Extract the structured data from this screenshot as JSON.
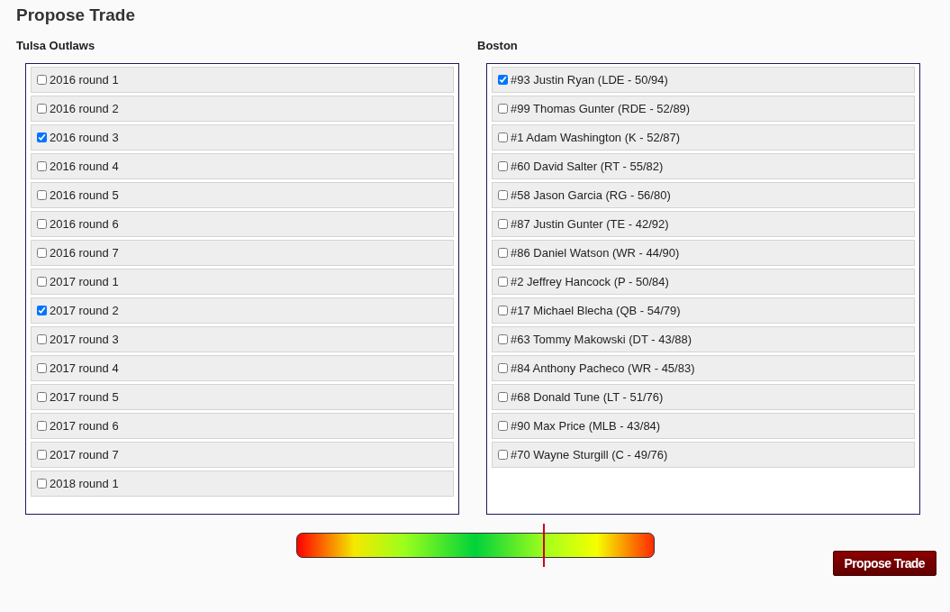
{
  "title": "Propose Trade",
  "teams": [
    {
      "name": "Tulsa Outlaws",
      "items": [
        {
          "label": "2016 round 1",
          "checked": false
        },
        {
          "label": "2016 round 2",
          "checked": false
        },
        {
          "label": "2016 round 3",
          "checked": true
        },
        {
          "label": "2016 round 4",
          "checked": false
        },
        {
          "label": "2016 round 5",
          "checked": false
        },
        {
          "label": "2016 round 6",
          "checked": false
        },
        {
          "label": "2016 round 7",
          "checked": false
        },
        {
          "label": "2017 round 1",
          "checked": false
        },
        {
          "label": "2017 round 2",
          "checked": true
        },
        {
          "label": "2017 round 3",
          "checked": false
        },
        {
          "label": "2017 round 4",
          "checked": false
        },
        {
          "label": "2017 round 5",
          "checked": false
        },
        {
          "label": "2017 round 6",
          "checked": false
        },
        {
          "label": "2017 round 7",
          "checked": false
        },
        {
          "label": "2018 round 1",
          "checked": false
        }
      ]
    },
    {
      "name": "Boston",
      "items": [
        {
          "label": "#93 Justin Ryan (LDE - 50/94)",
          "checked": true
        },
        {
          "label": "#99 Thomas Gunter (RDE - 52/89)",
          "checked": false
        },
        {
          "label": "#1 Adam Washington (K - 52/87)",
          "checked": false
        },
        {
          "label": "#60 David Salter (RT - 55/82)",
          "checked": false
        },
        {
          "label": "#58 Jason Garcia (RG - 56/80)",
          "checked": false
        },
        {
          "label": "#87 Justin Gunter (TE - 42/92)",
          "checked": false
        },
        {
          "label": "#86 Daniel Watson (WR - 44/90)",
          "checked": false
        },
        {
          "label": "#2 Jeffrey Hancock (P - 50/84)",
          "checked": false
        },
        {
          "label": "#17 Michael Blecha (QB - 54/79)",
          "checked": false
        },
        {
          "label": "#63 Tommy Makowski (DT - 43/88)",
          "checked": false
        },
        {
          "label": "#84 Anthony Pacheco (WR - 45/83)",
          "checked": false
        },
        {
          "label": "#68 Donald Tune (LT - 51/76)",
          "checked": false
        },
        {
          "label": "#90 Max Price (MLB - 43/84)",
          "checked": false
        },
        {
          "label": "#70 Wayne Sturgill (C - 49/76)",
          "checked": false
        }
      ]
    }
  ],
  "meter": {
    "level": 0.693
  },
  "submit": "Propose Trade"
}
